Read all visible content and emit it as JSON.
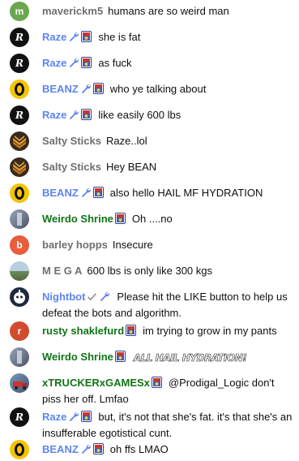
{
  "colors": {
    "moderator": "#5e84f1",
    "member": "#107516",
    "default_author": "#6f6f6f",
    "avatar_m": "#6aa84f",
    "avatar_b": "#e85d3b",
    "avatar_r": "#d14b2f"
  },
  "messages": [
    {
      "author": "maverickm5",
      "role": "plain",
      "avatar": "m",
      "avatar_kind": "letter-green",
      "badges": [],
      "text": "humans are so weird man"
    },
    {
      "author": "Raze",
      "role": "mod",
      "avatar": "R",
      "avatar_kind": "dark-r",
      "badges": [
        "wrench-icon",
        "member-badge-icon"
      ],
      "text": "she is fat"
    },
    {
      "author": "Raze",
      "role": "mod",
      "avatar": "R",
      "avatar_kind": "dark-r",
      "badges": [
        "wrench-icon",
        "member-badge-icon"
      ],
      "text": "as fuck"
    },
    {
      "author": "BEANZ",
      "role": "mod",
      "avatar": "B",
      "avatar_kind": "beanz",
      "badges": [
        "wrench-icon",
        "member-badge-icon"
      ],
      "text": "who ye talking about"
    },
    {
      "author": "Raze",
      "role": "mod",
      "avatar": "R",
      "avatar_kind": "dark-r",
      "badges": [
        "wrench-icon",
        "member-badge-icon"
      ],
      "text": "like easily 600 lbs"
    },
    {
      "author": "Salty Sticks",
      "role": "plain",
      "avatar": "",
      "avatar_kind": "salty",
      "badges": [],
      "text": "Raze..lol"
    },
    {
      "author": "Salty Sticks",
      "role": "plain",
      "avatar": "",
      "avatar_kind": "salty",
      "badges": [],
      "text": "Hey BEAN"
    },
    {
      "author": "BEANZ",
      "role": "mod",
      "avatar": "B",
      "avatar_kind": "beanz",
      "badges": [
        "wrench-icon",
        "member-badge-icon"
      ],
      "text": "also hello HAIL MF HYDRATION"
    },
    {
      "author": "Weirdo Shrine",
      "role": "member",
      "avatar": "",
      "avatar_kind": "photo-grey",
      "badges": [
        "member-badge-icon"
      ],
      "text": "Oh ....no"
    },
    {
      "author": "barley hopps",
      "role": "plain",
      "avatar": "b",
      "avatar_kind": "letter-orange",
      "badges": [],
      "text": "Insecure"
    },
    {
      "author": "M E G A",
      "role": "plain",
      "avatar": "",
      "avatar_kind": "photo-land",
      "badges": [],
      "text": "600 lbs is only like 300 kgs"
    },
    {
      "author": "Nightbot",
      "role": "mod",
      "avatar": "",
      "avatar_kind": "nightbot",
      "badges": [
        "verified-check-icon",
        "wrench-icon"
      ],
      "text": "Please hit the LIKE button to help us defeat the bots and algorithm."
    },
    {
      "author": "rusty shaklefurd",
      "role": "member",
      "avatar": "r",
      "avatar_kind": "letter-red",
      "badges": [
        "member-badge-icon"
      ],
      "text": "im trying to grow in my pants"
    },
    {
      "author": "Weirdo Shrine",
      "role": "member",
      "avatar": "",
      "avatar_kind": "photo-grey",
      "badges": [
        "member-badge-icon"
      ],
      "text": "",
      "sticker": "ALL HAIL HYDRATION!"
    },
    {
      "author": "xTRUCKERxGAMESx",
      "role": "member",
      "avatar": "",
      "avatar_kind": "photo-truck",
      "badges": [
        "member-badge-icon"
      ],
      "text": "@Prodigal_Logic don't piss her off. Lmfao"
    },
    {
      "author": "Raze",
      "role": "mod",
      "avatar": "R",
      "avatar_kind": "dark-r",
      "badges": [
        "wrench-icon",
        "member-badge-icon"
      ],
      "text": "but, it's not that she's fat. it's that she's an insufferable egotistical cunt."
    },
    {
      "author": "BEANZ",
      "role": "mod",
      "avatar": "B",
      "avatar_kind": "beanz",
      "badges": [
        "wrench-icon",
        "member-badge-icon"
      ],
      "text": "oh ffs LMAO"
    }
  ]
}
